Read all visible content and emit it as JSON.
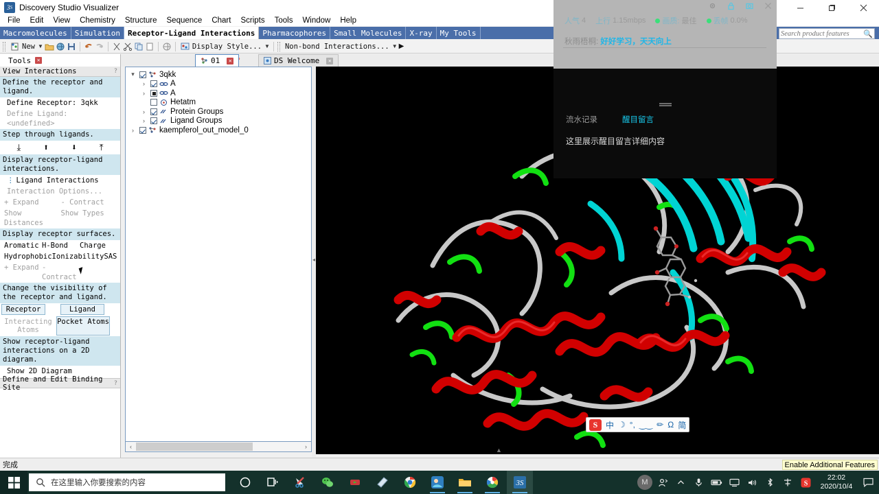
{
  "window": {
    "title": "Discovery Studio Visualizer",
    "app_icon": "ds-logo-icon",
    "minimize": "minimize-icon",
    "maximize": "maximize-icon",
    "close": "close-icon"
  },
  "menubar": {
    "items": [
      "File",
      "Edit",
      "View",
      "Chemistry",
      "Structure",
      "Sequence",
      "Chart",
      "Scripts",
      "Tools",
      "Window",
      "Help"
    ]
  },
  "ribbon": {
    "tabs": [
      {
        "label": "Macromolecules",
        "active": false
      },
      {
        "label": "Simulation",
        "active": false
      },
      {
        "label": "Receptor-Ligand Interactions",
        "active": true
      },
      {
        "label": "Pharmacophores",
        "active": false
      },
      {
        "label": "Small Molecules",
        "active": false
      },
      {
        "label": "X-ray",
        "active": false
      },
      {
        "label": "My Tools",
        "active": false
      }
    ],
    "search_placeholder": "Search product features"
  },
  "toolbar": {
    "new_label": "New",
    "display_style_label": "Display Style...",
    "nonbond_label": "Non-bond Interactions..."
  },
  "panel_tabs": {
    "tools_label": "Tools",
    "documents": [
      {
        "label": "DS Welcome",
        "active": false
      },
      {
        "label": "01",
        "active": true
      }
    ]
  },
  "tools_panel": {
    "header": "View Interactions",
    "sections": [
      {
        "band": "Define the receptor and ligand.",
        "rows": [
          {
            "text": "Define Receptor: 3qkk",
            "dim": false
          },
          {
            "text": "Define Ligand: <undefined>",
            "dim": true
          }
        ]
      },
      {
        "band": "Step through ligands.",
        "arrows": [
          "first-ligand-icon",
          "previous-ligand-icon",
          "next-ligand-icon",
          "last-ligand-icon"
        ]
      },
      {
        "band": "Display receptor-ligand interactions.",
        "rows": [
          {
            "text": "Ligand Interactions",
            "dim": false
          },
          {
            "text": "Interaction Options...",
            "dim": true
          }
        ],
        "cols": [
          {
            "cells": [
              "+ Expand",
              "- Contract"
            ],
            "dim": true
          },
          {
            "cells": [
              "Show Distances",
              "Show Types"
            ],
            "dim": true
          }
        ]
      },
      {
        "band": "Display receptor surfaces.",
        "cols": [
          {
            "cells": [
              "Aromatic",
              "H-Bond",
              "Charge"
            ],
            "dim": false
          },
          {
            "cells": [
              "Hydrophobic",
              "Ionizability",
              "SAS"
            ],
            "dim": false
          },
          {
            "cells": [
              "+ Expand",
              "- Contract"
            ],
            "dim": true
          }
        ]
      },
      {
        "band": "Change the visibility of the receptor and ligand.",
        "buttons": [
          {
            "label": "Receptor",
            "style": "raised"
          },
          {
            "label": "Ligand",
            "style": "raised"
          },
          {
            "label": "Interacting Atoms",
            "style": "flat"
          },
          {
            "label": "Pocket Atoms",
            "style": "raised"
          }
        ]
      },
      {
        "band": "Show receptor-ligand interactions on a 2D diagram.",
        "rows": [
          {
            "text": "Show 2D Diagram",
            "dim": false
          }
        ]
      }
    ],
    "footer": "Define and Edit Binding Site"
  },
  "tree": {
    "nodes": [
      {
        "indent": 0,
        "twisty": "expanded",
        "check": "checked",
        "icon": "molecule-icon",
        "label": "3qkk"
      },
      {
        "indent": 1,
        "twisty": "collapsed",
        "check": "checked",
        "icon": "chain-icon",
        "label": "A"
      },
      {
        "indent": 1,
        "twisty": "collapsed",
        "check": "partial",
        "icon": "chain-icon",
        "label": "A"
      },
      {
        "indent": 1,
        "twisty": "none",
        "check": "unchecked",
        "icon": "hetatm-icon",
        "label": "Hetatm"
      },
      {
        "indent": 1,
        "twisty": "collapsed",
        "check": "checked",
        "icon": "group-icon",
        "label": "Protein Groups"
      },
      {
        "indent": 1,
        "twisty": "collapsed",
        "check": "checked",
        "icon": "group-icon",
        "label": "Ligand Groups"
      },
      {
        "indent": 0,
        "twisty": "collapsed",
        "check": "checked",
        "icon": "molecule-icon",
        "label": "kaempferol_out_model_0"
      }
    ]
  },
  "overlay": {
    "stats": [
      {
        "key": "人气",
        "value": "4",
        "dot": false
      },
      {
        "key": "上行",
        "value": "1.15mbps",
        "dot": false
      },
      {
        "key": "画质:",
        "value": "最佳",
        "dot": true
      },
      {
        "key": "丢帧",
        "value": "0.0%",
        "dot": true
      }
    ],
    "notice_user": "秋雨梧桐:",
    "notice_text": "好好学习，天天向上",
    "tabs": [
      {
        "label": "流水记录",
        "active": false
      },
      {
        "label": "醒目留言",
        "active": true
      }
    ],
    "body": "这里展示醒目留言详细内容",
    "icons": [
      "settings-icon",
      "lock-icon",
      "screenshot-icon",
      "close-icon"
    ]
  },
  "ime": {
    "logo": "S",
    "items": [
      "中",
      "☽",
      "°,",
      "‿‿",
      "✏",
      "Ω",
      "简"
    ],
    "names": [
      "sogou-logo-icon",
      "chinese-mode-icon",
      "moon-icon",
      "punctuation-icon",
      "emoji-icon",
      "pencil-icon",
      "symbol-icon",
      "simplified-icon"
    ]
  },
  "statusbar": {
    "message": "完成",
    "tip": "Enable Additional Features"
  },
  "taskbar": {
    "start": "windows-start-icon",
    "search_placeholder": "在这里输入你要搜索的内容",
    "apps": [
      {
        "name": "cortana-icon"
      },
      {
        "name": "task-view-icon"
      },
      {
        "name": "snipaste-icon"
      },
      {
        "name": "wechat-icon"
      },
      {
        "name": "media-player-icon"
      },
      {
        "name": "notes-icon"
      },
      {
        "name": "chrome-icon"
      },
      {
        "name": "game-icon"
      },
      {
        "name": "file-explorer-icon"
      },
      {
        "name": "photos-icon"
      },
      {
        "name": "discovery-studio-icon"
      }
    ],
    "tray_icons": [
      "people-icon",
      "show-hidden-icon",
      "microphone-icon",
      "battery-icon",
      "display-icon",
      "volume-icon",
      "bluetooth-icon",
      "ime-icon",
      "sogou-icon"
    ],
    "clock_time": "22:02",
    "clock_date": "2020/10/4",
    "action_center": "action-center-icon",
    "user": "M"
  },
  "viewport": {
    "description": "3D protein ribbon structure of 3qkk with kaempferol ligand",
    "colors": {
      "helix": "#cc0000",
      "sheet": "#00cccc",
      "turn": "#00dd00",
      "coil": "#c8c8c8",
      "background": "#000000"
    }
  }
}
